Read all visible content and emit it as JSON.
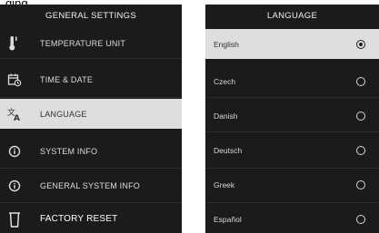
{
  "caption": "ging",
  "general_settings": {
    "title": "GENERAL SETTINGS",
    "items": [
      {
        "label": "TEMPERATURE UNIT",
        "icon": "thermometer-icon",
        "selected": false
      },
      {
        "label": "TIME & DATE",
        "icon": "calendar-clock-icon",
        "selected": false
      },
      {
        "label": "LANGUAGE",
        "icon": "translate-icon",
        "selected": true
      },
      {
        "label": "SYSTEM INFO",
        "icon": "info-icon",
        "selected": false
      },
      {
        "label": "GENERAL SYSTEM INFO",
        "icon": "info-icon",
        "selected": false
      },
      {
        "label": "FACTORY RESET",
        "icon": "trash-icon",
        "selected": false
      }
    ]
  },
  "language": {
    "title": "LANGUAGE",
    "options": [
      {
        "label": "English",
        "selected": true
      },
      {
        "label": "Czech",
        "selected": false
      },
      {
        "label": "Danish",
        "selected": false
      },
      {
        "label": "Deutsch",
        "selected": false
      },
      {
        "label": "Greek",
        "selected": false
      },
      {
        "label": "Español",
        "selected": false
      }
    ]
  },
  "colors": {
    "panel_background": "#1b1b1b",
    "selected_background": "#dedede",
    "text": "#dcdcdc"
  }
}
